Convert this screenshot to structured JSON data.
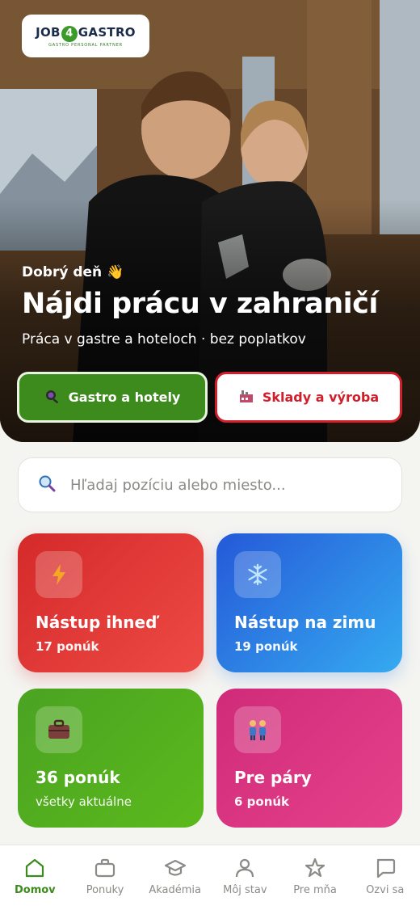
{
  "brand": {
    "logo_prefix": "JOB",
    "logo_number": "4",
    "logo_suffix": "GASTRO",
    "logo_tagline": "GASTRO PERSONAL PARTNER"
  },
  "hero": {
    "greeting": "Dobrý deň 👋",
    "title": "Nájdi prácu v zahraničí",
    "subtitle": "Práca v gastre a hoteloch · bez poplatkov"
  },
  "segments": [
    {
      "label": "Gastro a hotely",
      "icon": "pan-icon"
    },
    {
      "label": "Sklady a výroba",
      "icon": "factory-icon"
    }
  ],
  "search": {
    "placeholder": "Hľadaj pozíciu alebo miesto..."
  },
  "cards": [
    {
      "title": "Nástup ihneď",
      "subtitle": "17 ponúk",
      "icon": "lightning-icon"
    },
    {
      "title": "Nástup na zimu",
      "subtitle": "19 ponúk",
      "icon": "snowflake-icon"
    },
    {
      "title": "36 ponúk",
      "subtitle": "všetky aktuálne",
      "icon": "briefcase-icon"
    },
    {
      "title": "Pre páry",
      "subtitle": "6 ponúk",
      "icon": "couple-icon"
    }
  ],
  "nav": [
    {
      "label": "Domov",
      "icon": "home-icon",
      "active": true
    },
    {
      "label": "Ponuky",
      "icon": "briefcase-icon"
    },
    {
      "label": "Akadémia",
      "icon": "graduation-cap-icon"
    },
    {
      "label": "Môj stav",
      "icon": "person-icon"
    },
    {
      "label": "Pre mňa",
      "icon": "star-icon"
    },
    {
      "label": "Ozvi sa",
      "icon": "chat-bubble-icon"
    }
  ],
  "colors": {
    "accent_green": "#3d8a1d",
    "accent_red": "#d11e2a",
    "background": "#f4f4f1"
  }
}
